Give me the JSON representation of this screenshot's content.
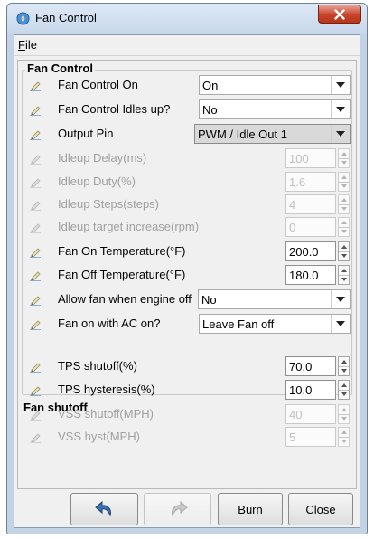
{
  "window": {
    "title": "Fan Control",
    "menu": {
      "file": "File"
    }
  },
  "panel": {
    "section_fan_control": "Fan Control",
    "section_fan_shutoff": "Fan shutoff",
    "rows": [
      {
        "label": "Fan Control On",
        "type": "combo",
        "value": "On",
        "enabled": true
      },
      {
        "label": "Fan Control Idles up?",
        "type": "combo",
        "value": "No",
        "enabled": true
      },
      {
        "label": "Output Pin",
        "type": "combo",
        "value": "PWM / Idle Out 1",
        "enabled": true
      },
      {
        "label": "Idleup Delay(ms)",
        "type": "spin",
        "value": "100",
        "enabled": false
      },
      {
        "label": "Idleup Duty(%)",
        "type": "spin",
        "value": "1.6",
        "enabled": false
      },
      {
        "label": "Idleup Steps(steps)",
        "type": "spin",
        "value": "4",
        "enabled": false
      },
      {
        "label": "Idleup target increase(rpm)",
        "type": "spin",
        "value": "0",
        "enabled": false
      },
      {
        "label": "Fan On Temperature(°F)",
        "type": "spin",
        "value": "200.0",
        "enabled": true
      },
      {
        "label": "Fan Off Temperature(°F)",
        "type": "spin",
        "value": "180.0",
        "enabled": true
      },
      {
        "label": "Allow fan when engine off",
        "type": "combo",
        "value": "No",
        "enabled": true
      },
      {
        "label": "Fan on with AC on?",
        "type": "combo",
        "value": "Leave Fan off",
        "enabled": true
      },
      {
        "label": "TPS shutoff(%)",
        "type": "spin",
        "value": "70.0",
        "enabled": true
      },
      {
        "label": "TPS hysteresis(%)",
        "type": "spin",
        "value": "10.0",
        "enabled": true
      },
      {
        "label": "VSS shutoff(MPH)",
        "type": "spin",
        "value": "40",
        "enabled": false
      },
      {
        "label": "VSS hyst(MPH)",
        "type": "spin",
        "value": "5",
        "enabled": false
      }
    ]
  },
  "buttons": {
    "undo_icon": "undo-arrow-icon",
    "redo_icon": "redo-arrow-icon",
    "burn": "Burn",
    "close": "Close"
  },
  "colors": {
    "titlebar": "#c7d7eb",
    "close_button": "#c7442a",
    "panel_bg": "#f0f0f0",
    "disabled_text": "#a0a0a0"
  }
}
